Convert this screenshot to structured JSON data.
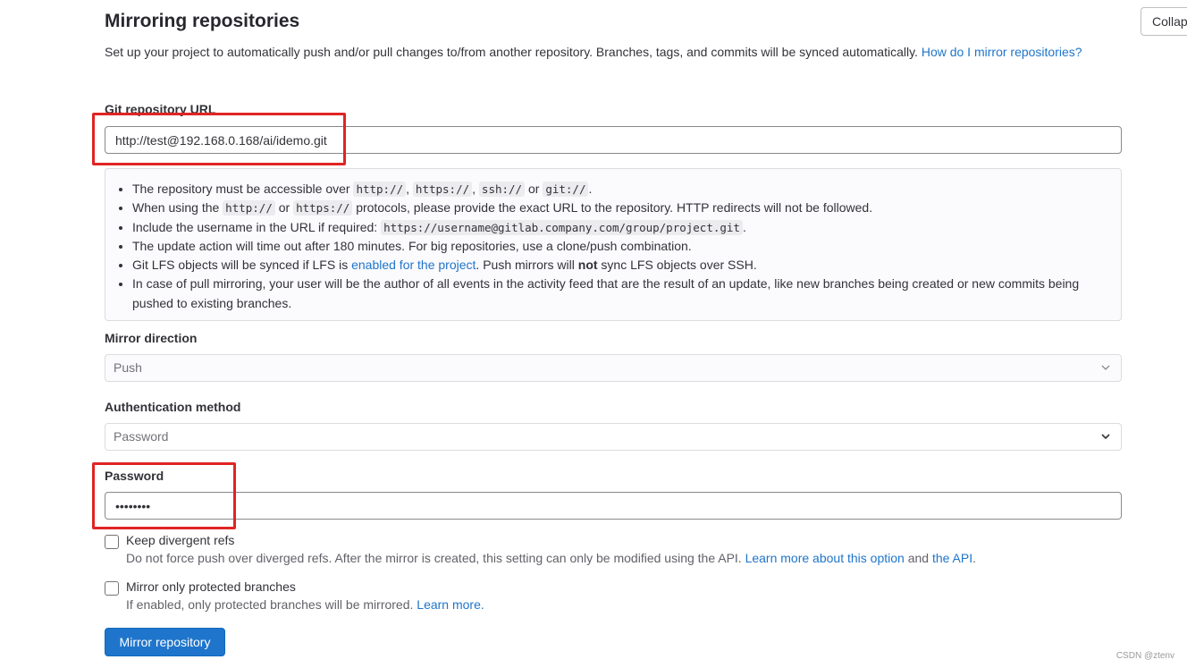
{
  "header": {
    "title": "Mirroring repositories",
    "collapse_label": "Collap"
  },
  "description": {
    "text": "Set up your project to automatically push and/or pull changes to/from another repository. Branches, tags, and commits will be synced automatically. ",
    "link": "How do I mirror repositories?"
  },
  "git_url": {
    "label": "Git repository URL",
    "value": "http://test@192.168.0.168/ai/idemo.git"
  },
  "help": {
    "item1_pre": "The repository must be accessible over ",
    "item1_code1": "http://",
    "item1_sep1": ", ",
    "item1_code2": "https://",
    "item1_sep2": ", ",
    "item1_code3": "ssh://",
    "item1_sep3": " or ",
    "item1_code4": "git://",
    "item1_post": ".",
    "item2_pre": "When using the ",
    "item2_code1": "http://",
    "item2_mid": " or ",
    "item2_code2": "https://",
    "item2_post": " protocols, please provide the exact URL to the repository. HTTP redirects will not be followed.",
    "item3_pre": "Include the username in the URL if required: ",
    "item3_code": "https://username@gitlab.company.com/group/project.git",
    "item3_post": ".",
    "item4": "The update action will time out after 180 minutes. For big repositories, use a clone/push combination.",
    "item5_pre": "Git LFS objects will be synced if LFS is ",
    "item5_link": "enabled for the project",
    "item5_mid": ". Push mirrors will ",
    "item5_bold": "not",
    "item5_post": " sync LFS objects over SSH.",
    "item6": "In case of pull mirroring, your user will be the author of all events in the activity feed that are the result of an update, like new branches being created or new commits being pushed to existing branches."
  },
  "mirror_direction": {
    "label": "Mirror direction",
    "value": "Push"
  },
  "auth_method": {
    "label": "Authentication method",
    "value": "Password"
  },
  "password": {
    "label": "Password",
    "value": "••••••••"
  },
  "keep_divergent": {
    "label": "Keep divergent refs",
    "help_pre": "Do not force push over diverged refs. After the mirror is created, this setting can only be modified using the API. ",
    "help_link1": "Learn more about this option",
    "help_mid": " and ",
    "help_link2": "the API",
    "help_post": "."
  },
  "protected_only": {
    "label": "Mirror only protected branches",
    "help_pre": "If enabled, only protected branches will be mirrored. ",
    "help_link": "Learn more."
  },
  "submit_label": "Mirror repository",
  "watermark": "CSDN @ztenv",
  "colors": {
    "link": "#1f75cb",
    "primary_button": "#1f75cb",
    "highlight_box": "#e02424"
  },
  "icons": [
    "chevron-down-icon"
  ]
}
